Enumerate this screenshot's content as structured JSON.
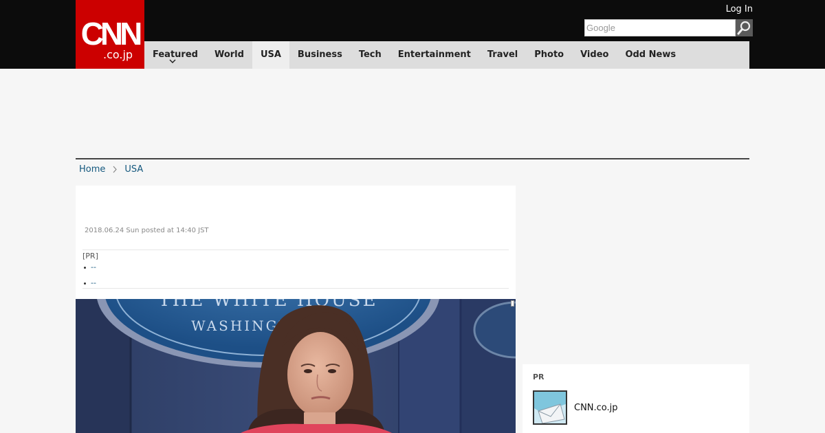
{
  "header": {
    "logo": {
      "main": "CNN",
      "sub": ".co.jp"
    },
    "login_label": "Log In",
    "search": {
      "placeholder": "Google"
    }
  },
  "nav": {
    "items": [
      {
        "label": "Featured",
        "has_dropdown": true
      },
      {
        "label": "World"
      },
      {
        "label": "USA",
        "active": true
      },
      {
        "label": "Business"
      },
      {
        "label": "Tech"
      },
      {
        "label": "Entertainment"
      },
      {
        "label": "Travel"
      },
      {
        "label": "Photo"
      },
      {
        "label": "Video"
      },
      {
        "label": "Odd News"
      }
    ]
  },
  "breadcrumb": {
    "home": "Home",
    "current": "USA"
  },
  "article": {
    "date": "2018.06.24 Sun posted at 14:40 JST",
    "pr": {
      "label": "[PR]",
      "links": [
        "--",
        "--"
      ]
    }
  },
  "sidebar": {
    "pr_label": "PR",
    "item_text": "CNN.co.jp"
  },
  "colors": {
    "brand_red": "#cc0000",
    "topbar": "#0c0c0c",
    "nav_bg": "#dddddd",
    "link": "#14587e"
  }
}
